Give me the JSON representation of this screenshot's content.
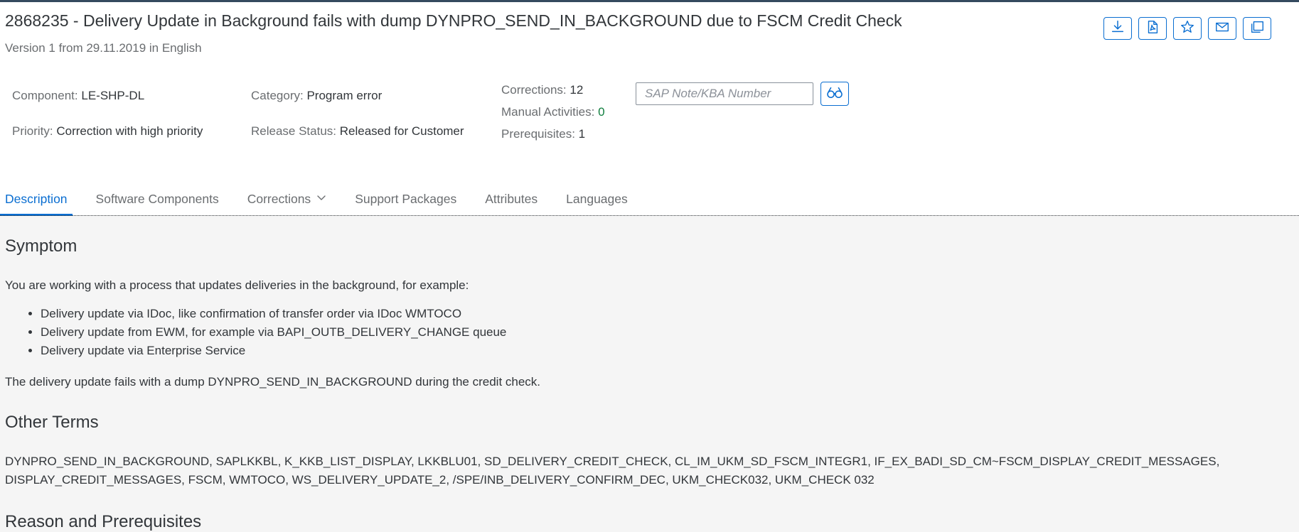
{
  "note": {
    "title": "2868235 - Delivery Update in Background fails with dump DYNPRO_SEND_IN_BACKGROUND due to FSCM Credit Check",
    "subtitle": "Version 1 from 29.11.2019 in English"
  },
  "actions": [
    {
      "icon": "download-icon"
    },
    {
      "icon": "pdf-icon"
    },
    {
      "icon": "star-icon"
    },
    {
      "icon": "email-icon"
    },
    {
      "icon": "copy-icon"
    }
  ],
  "meta": {
    "component_label": "Component:",
    "component_value": "LE-SHP-DL",
    "priority_label": "Priority:",
    "priority_value": "Correction with high priority",
    "category_label": "Category:",
    "category_value": "Program error",
    "release_label": "Release Status:",
    "release_value": "Released for Customer",
    "corrections_label": "Corrections:",
    "corrections_value": "12",
    "manual_label": "Manual Activities:",
    "manual_value": "0",
    "prereq_label": "Prerequisites:",
    "prereq_value": "1"
  },
  "search": {
    "placeholder": "SAP Note/KBA Number",
    "button_icon": "glasses-icon"
  },
  "tabs": [
    {
      "label": "Description",
      "active": true
    },
    {
      "label": "Software Components"
    },
    {
      "label": "Corrections",
      "dropdown": true
    },
    {
      "label": "Support Packages"
    },
    {
      "label": "Attributes"
    },
    {
      "label": "Languages"
    }
  ],
  "symptom": {
    "heading": "Symptom",
    "intro": "You are working with a process that updates deliveries in the background, for example:",
    "bullets": [
      "Delivery update via IDoc, like confirmation of transfer order via IDoc WMTOCO",
      "Delivery update from EWM, for example via BAPI_OUTB_DELIVERY_CHANGE queue",
      "Delivery update via Enterprise Service"
    ],
    "outro": "The delivery update fails with a dump DYNPRO_SEND_IN_BACKGROUND during the credit check."
  },
  "other_terms": {
    "heading": "Other Terms",
    "line1": "DYNPRO_SEND_IN_BACKGROUND, SAPLKKBL, K_KKB_LIST_DISPLAY, LKKBLU01, SD_DELIVERY_CREDIT_CHECK, CL_IM_UKM_SD_FSCM_INTEGR1, IF_EX_BADI_SD_CM~FSCM_DISPLAY_CREDIT_MESSAGES,",
    "line2": "DISPLAY_CREDIT_MESSAGES, FSCM, WMTOCO, WS_DELIVERY_UPDATE_2, /SPE/INB_DELIVERY_CONFIRM_DEC, UKM_CHECK032, UKM_CHECK 032"
  },
  "reason": {
    "heading": "Reason and Prerequisites"
  },
  "colors": {
    "accent": "#0a6ed1",
    "positive": "#107e3e",
    "shell": "#354a5f"
  }
}
